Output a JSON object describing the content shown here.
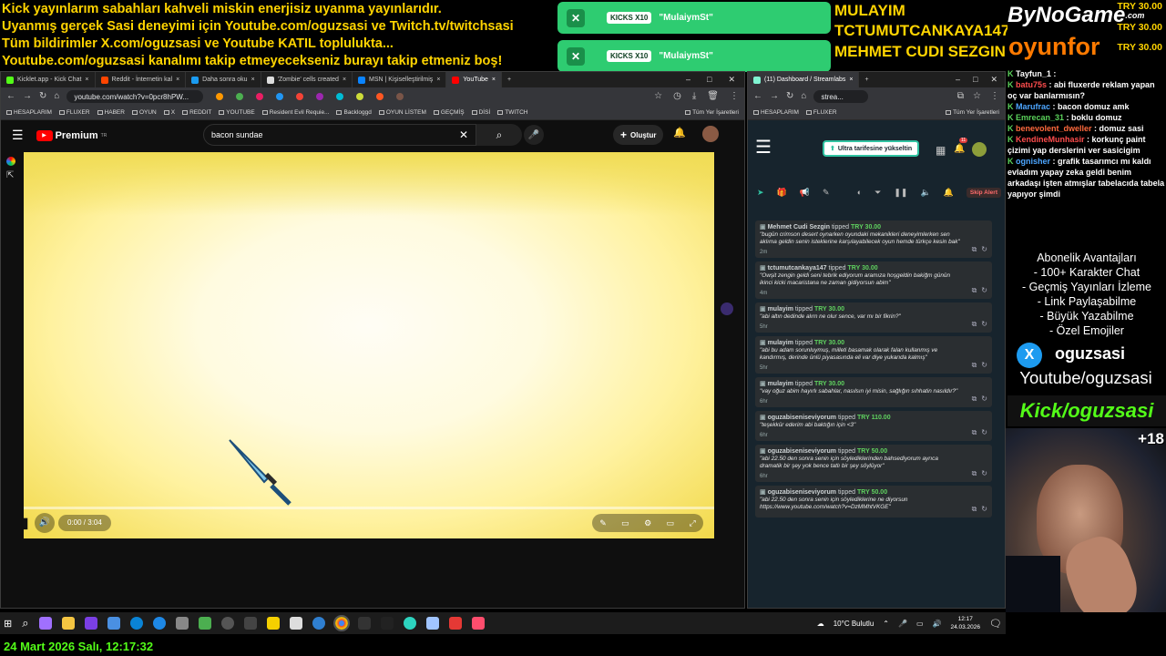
{
  "ticker": {
    "line1": "Kick yayınlarım sabahları kahveli miskin enerjisiz uyanma yayınlarıdır.",
    "line2": "Uyanmış gerçek Sasi deneyimi için Youtube.com/oguzsasi ve Twitch.tv/twitchsasi",
    "line3": "Tüm bildirimler X.com/oguzsasi ve Youtube KATIL toplulukta...",
    "line4": "Youtube.com/oguzsasi kanalımı takip etmeyecekseniz burayı takip etmeniz boş!"
  },
  "alerts": [
    {
      "count": "KICKS X10",
      "user": "\"MulaiymSt\""
    },
    {
      "count": "KICKS X10",
      "user": "\"MulaiymSt\""
    }
  ],
  "tippers": {
    "n1": "MULAYIM",
    "n2": "TCTUMUTCANKAYA147",
    "n3": "MEHMET CUDI SEZGIN"
  },
  "brand": {
    "bynogame": "ByNoGame",
    "bynogame_com": ".com",
    "oyunfor": "oyunfor",
    "amt1": "TRY 30.00",
    "amt2": "TRY 30.00",
    "amt3": "TRY 30.00"
  },
  "browser1": {
    "tabs": [
      "Kicklet.app - Kick Chat",
      "Reddit - İnternetin kal",
      "Daha sonra oku",
      "'Zombie' cells created",
      "MSN | Kişiselleştirilmiş",
      "YouTube"
    ],
    "url": "youtube.com/watch?v=0pcr8hPW...",
    "bookmarks": [
      "HESAPLARIM",
      "FLUXER",
      "HABER",
      "OYUN",
      "X",
      "REDDIT",
      "YOUTUBE",
      "Resident Evil Requie...",
      "Backloggd",
      "OYUN LİSTEM",
      "GEÇMİŞ",
      "DİSİ",
      "TWITCH",
      "Tüm Yer İşaretleri"
    ]
  },
  "youtube": {
    "logo": "Premium",
    "logo_sup": "TR",
    "search_value": "bacon sundae",
    "create_label": "Oluştur",
    "time": "0:00 / 3:04"
  },
  "browser2": {
    "tab": "(11) Dashboard / Streamlabs",
    "url": "strea...",
    "bookmarks": [
      "HESAPLARIM",
      "FLUXER",
      "Tüm Yer İşaretleri"
    ]
  },
  "dashboard": {
    "upgrade_label": "Ultra tarifesine yükseltin",
    "notif_count": "11",
    "skip_label": "Skip Alert",
    "events": [
      {
        "user": "Mehmet Cudi Sezgin",
        "verb": "tipped",
        "amount": "TRY 30.00",
        "msg": "\"bugün crimson desert oynarken oyundaki mekanikleri deneyimlerken sen aklıma geldin senin isteklerine karşılayabilecek oyun hemde türkçe kesin bak\"",
        "time": "2m"
      },
      {
        "user": "tctumutcankaya147",
        "verb": "tipped",
        "amount": "TRY 30.00",
        "msg": "\"Owşit zengin geldi seni tebrik ediyorum aramıza hoşgeldin bakiğm günün ikinci kicki macaristana ne zaman gidiyorsun abim\"",
        "time": "4m"
      },
      {
        "user": "mulayim",
        "verb": "tipped",
        "amount": "TRY 30.00",
        "msg": "\"abi altın dedinde alırn ne olur sence, var mı bir fikrin?\"",
        "time": "5hr"
      },
      {
        "user": "mulayim",
        "verb": "tipped",
        "amount": "TRY 30.00",
        "msg": "\"abi bu adam sorunluymuş, milleti basamak olarak falan kullanmış ve kandırmış, derinde ünlü piyasasında eli var diye yukarıda kalmış\"",
        "time": "5hr"
      },
      {
        "user": "mulayim",
        "verb": "tipped",
        "amount": "TRY 30.00",
        "msg": "\"vay oğuz abim hayırlı sabahlar, nasılsın iyi misin, sağlığın sıhhatin nasıldır?\"",
        "time": "6hr"
      },
      {
        "user": "oguzabiseniseviyorum",
        "verb": "tipped",
        "amount": "TRY 110.00",
        "msg": "\"teşekkür ederim abi baktığın için <3\"",
        "time": "6hr"
      },
      {
        "user": "oguzabiseniseviyorum",
        "verb": "tipped",
        "amount": "TRY 50.00",
        "msg": "\"abi 22.50 den sonra senin için söylediklerinden bahsediyorum ayrıca dramatik bir şey yok bence tatlı bir şey söylüyor\"",
        "time": "6hr"
      },
      {
        "user": "oguzabiseniseviyorum",
        "verb": "tipped",
        "amount": "TRY 50.00",
        "msg": "\"abi 22.50 den sonra senin için söylediklerine ne diyorsun https://www.youtube.com/watch?v=DzMMhtVKGE\"",
        "time": ""
      }
    ]
  },
  "chat": [
    {
      "user": "Tayfun_1",
      "color": "#ffffff",
      "text": ""
    },
    {
      "user": "batu75s",
      "color": "#ff4d4d",
      "text": "abi fluxerde reklam yapan oç var banlarmısın?"
    },
    {
      "user": "Marufrac",
      "color": "#4da6ff",
      "text": "bacon domuz amk"
    },
    {
      "user": "Emrecan_31",
      "color": "#5ad15a",
      "text": "boklu domuz"
    },
    {
      "user": "benevolent_dweller",
      "color": "#ff6a3d",
      "text": "domuz sasi"
    },
    {
      "user": "KendineMunhasir",
      "color": "#ff4d4d",
      "text": "korkunç paint çizimi yap derslerini ver sasicigim"
    },
    {
      "user": "ognisher",
      "color": "#4da6ff",
      "text": "grafik tasarımcı mı kaldı evladım yapay zeka geldi benim arkadaşı işten atmışlar tabelacıda tabela yapıyor şimdi"
    }
  ],
  "sub_perks": {
    "title": "Abonelik Avantajları",
    "items": [
      "- 100+ Karakter Chat",
      "- Geçmiş Yayınları İzleme",
      "- Link Paylaşabilme",
      "- Büyük Yazabilme",
      "- Özel Emojiler"
    ]
  },
  "socials": {
    "x_handle": "oguzsasi",
    "youtube": "Youtube/oguzsasi",
    "kick": "Kick/oguzsasi",
    "age": "+18"
  },
  "taskbar": {
    "weather": "10°C  Bulutlu",
    "time": "12:17",
    "date": "24.03.2026"
  },
  "bottom_clock": "24 Mart 2026 Salı, 12:17:32",
  "colors": {
    "ticker": "#ffd400",
    "kick_green": "#2ecc71",
    "youtube_red": "#ff0000"
  }
}
